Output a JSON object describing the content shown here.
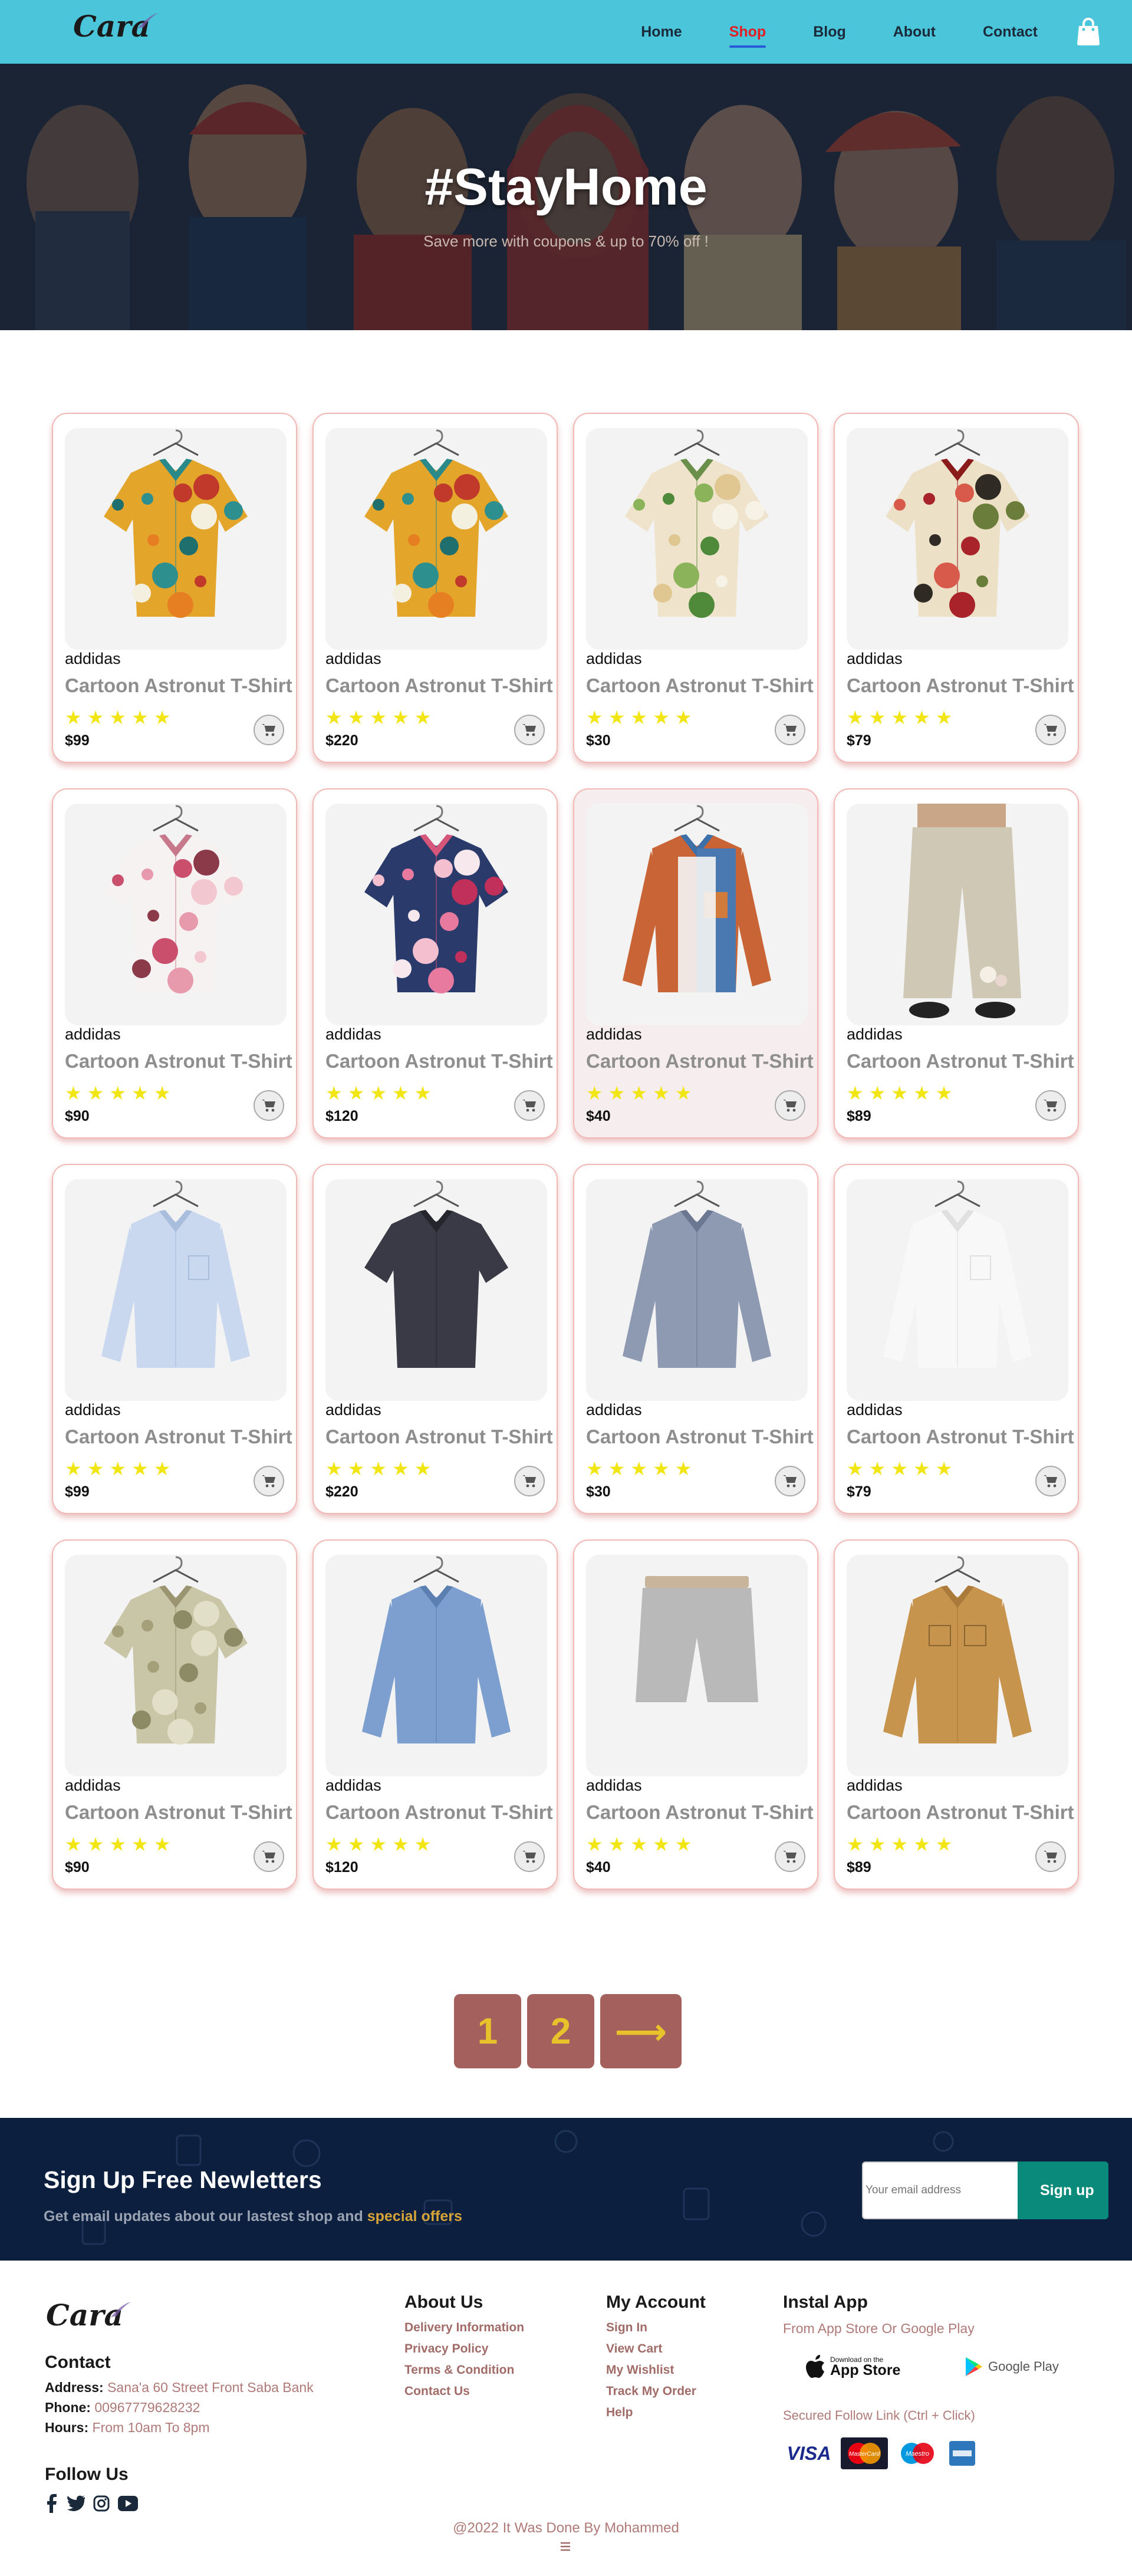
{
  "header": {
    "logo_text": "Cara",
    "nav": [
      {
        "label": "Home",
        "active": false
      },
      {
        "label": "Shop",
        "active": true
      },
      {
        "label": "Blog",
        "active": false
      },
      {
        "label": "About",
        "active": false
      },
      {
        "label": "Contact",
        "active": false
      }
    ],
    "bag_icon": "shopping-bag-icon"
  },
  "hero": {
    "title": "#StayHome",
    "subtitle": "Save more with coupons & up to 70% off !"
  },
  "products": [
    {
      "brand": "addidas",
      "name": "Cartoon Astronut T-Shirt",
      "rating": 5,
      "price": "$99",
      "image": "shirt-floral-yellow"
    },
    {
      "brand": "addidas",
      "name": "Cartoon Astronut T-Shirt",
      "rating": 5,
      "price": "$220",
      "image": "shirt-floral-yellow"
    },
    {
      "brand": "addidas",
      "name": "Cartoon Astronut T-Shirt",
      "rating": 5,
      "price": "$30",
      "image": "shirt-tropical-green"
    },
    {
      "brand": "addidas",
      "name": "Cartoon Astronut T-Shirt",
      "rating": 5,
      "price": "$79",
      "image": "shirt-floral-cream"
    },
    {
      "brand": "addidas",
      "name": "Cartoon Astronut T-Shirt",
      "rating": 5,
      "price": "$90",
      "image": "shirt-blossom-white"
    },
    {
      "brand": "addidas",
      "name": "Cartoon Astronut T-Shirt",
      "rating": 5,
      "price": "$120",
      "image": "shirt-floral-navy"
    },
    {
      "brand": "addidas",
      "name": "Cartoon Astronut T-Shirt",
      "rating": 5,
      "price": "$40",
      "image": "shirt-orange-denim"
    },
    {
      "brand": "addidas",
      "name": "Cartoon Astronut T-Shirt",
      "rating": 5,
      "price": "$89",
      "image": "pants-beige"
    },
    {
      "brand": "addidas",
      "name": "Cartoon Astronut T-Shirt",
      "rating": 5,
      "price": "$99",
      "image": "shirt-light-blue"
    },
    {
      "brand": "addidas",
      "name": "Cartoon Astronut T-Shirt",
      "rating": 5,
      "price": "$220",
      "image": "shirt-dark-short"
    },
    {
      "brand": "addidas",
      "name": "Cartoon Astronut T-Shirt",
      "rating": 5,
      "price": "$30",
      "image": "shirt-gray-check"
    },
    {
      "brand": "addidas",
      "name": "Cartoon Astronut T-Shirt",
      "rating": 5,
      "price": "$79",
      "image": "shirt-white"
    },
    {
      "brand": "addidas",
      "name": "Cartoon Astronut T-Shirt",
      "rating": 5,
      "price": "$90",
      "image": "shirt-olive-print"
    },
    {
      "brand": "addidas",
      "name": "Cartoon Astronut T-Shirt",
      "rating": 5,
      "price": "$120",
      "image": "shirt-denim-blue"
    },
    {
      "brand": "addidas",
      "name": "Cartoon Astronut T-Shirt",
      "rating": 5,
      "price": "$40",
      "image": "shorts-gray"
    },
    {
      "brand": "addidas",
      "name": "Cartoon Astronut T-Shirt",
      "rating": 5,
      "price": "$89",
      "image": "shirt-tan-jacket"
    }
  ],
  "pagination": {
    "pages": [
      "1",
      "2"
    ],
    "next": "⟶"
  },
  "newsletter": {
    "title": "Sign Up Free Newletters",
    "subtitle_prefix": "Get email updates about our lastest shop and ",
    "subtitle_highlight": "special offers",
    "input_placeholder": "Your email address",
    "button_label": "Sign up"
  },
  "footer": {
    "logo_text": "Cara",
    "contact": {
      "heading": "Contact",
      "address_label": "Address:",
      "address": "Sana'a 60 Street Front Saba Bank",
      "phone_label": "Phone:",
      "phone": "00967779628232",
      "hours_label": "Hours:",
      "hours": "From 10am To 8pm"
    },
    "follow_heading": "Follow Us",
    "social_icons": [
      "facebook-icon",
      "twitter-icon",
      "instagram-icon",
      "youtube-icon"
    ],
    "about": {
      "heading": "About Us",
      "links": [
        "Delivery Information",
        "Privacy Policy",
        "Terms & Condition",
        "Contact Us"
      ]
    },
    "account": {
      "heading": "My Account",
      "links": [
        "Sign In",
        "View Cart",
        "My Wishlist",
        "Track My Order",
        "Help"
      ]
    },
    "install": {
      "heading": "Instal App",
      "subtitle": "From App Store Or Google Play",
      "app_store_small": "Download on the",
      "app_store": "App Store",
      "google_play": "Google Play",
      "secured": "Secured Follow Link (Ctrl + Click)",
      "payments": [
        "VISA",
        "MasterCard",
        "Maestro",
        "AMEX"
      ]
    },
    "copyright": "@2022 It Was Done By Mohammed"
  },
  "colors": {
    "header_bg": "#4bc5d9",
    "nav_active": "#e31d24",
    "star": "#f2e514",
    "card_border": "#f2b8b6",
    "pager_bg": "#a4605c",
    "pager_text": "#e8c22a",
    "newsletter_bg": "#0d1f3e",
    "signup_btn": "#0a8a7a",
    "footer_link": "#a16b68"
  }
}
